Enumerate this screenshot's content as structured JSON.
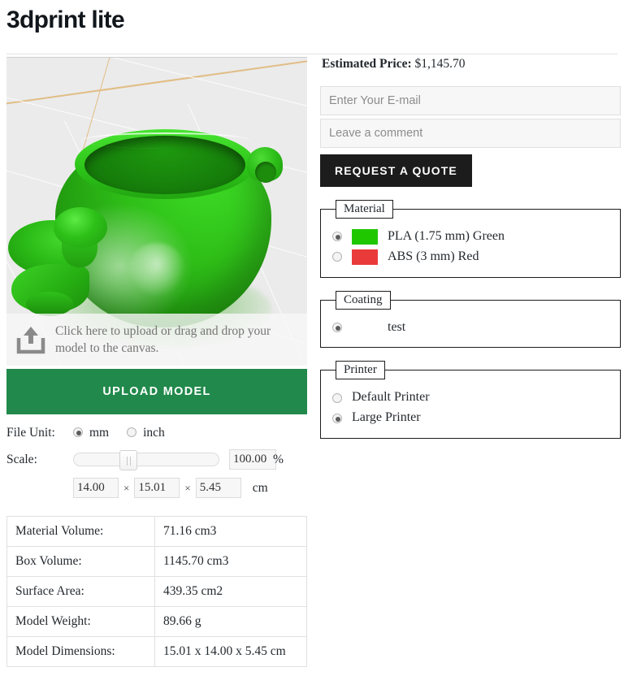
{
  "page": {
    "title": "3dprint lite"
  },
  "viewer": {
    "upload_hint": "Click here to upload or drag and drop your model to the canvas.",
    "upload_icon": "upload-arrow-icon",
    "upload_button_label": "UPLOAD MODEL",
    "model_color": "#2cbd18",
    "background_color": "#ebebeb",
    "button_color": "#21894b"
  },
  "file_unit": {
    "label": "File Unit:",
    "options": [
      {
        "label": "mm",
        "selected": true
      },
      {
        "label": "inch",
        "selected": false
      }
    ]
  },
  "scale": {
    "label": "Scale:",
    "value": "100.00",
    "unit": "%",
    "slider_position_pct": 33
  },
  "dimensions": {
    "x": "14.00",
    "y": "15.01",
    "z": "5.45",
    "separator": "×",
    "unit": "cm"
  },
  "info_table": {
    "rows": [
      {
        "key": "Material Volume:",
        "value": "71.16 cm3"
      },
      {
        "key": "Box Volume:",
        "value": "1145.70 cm3"
      },
      {
        "key": "Surface Area:",
        "value": "439.35 cm2"
      },
      {
        "key": "Model Weight:",
        "value": "89.66 g"
      },
      {
        "key": "Model Dimensions:",
        "value": "15.01 x 14.00 x 5.45 cm"
      }
    ]
  },
  "quote": {
    "price_label": "Estimated Price:",
    "price_value": "$1,145.70",
    "email_placeholder": "Enter Your E-mail",
    "email_value": "",
    "comment_placeholder": "Leave a comment",
    "comment_value": "",
    "button_label": "REQUEST A QUOTE",
    "button_color": "#1c1c1c"
  },
  "material": {
    "legend": "Material",
    "options": [
      {
        "label": "PLA (1.75 mm) Green",
        "color": "#1fc700",
        "selected": true
      },
      {
        "label": "ABS (3 mm) Red",
        "color": "#ea3b3b",
        "selected": false
      }
    ]
  },
  "coating": {
    "legend": "Coating",
    "options": [
      {
        "label": "test",
        "color": "",
        "selected": true
      }
    ]
  },
  "printer": {
    "legend": "Printer",
    "options": [
      {
        "label": "Default Printer",
        "selected": false
      },
      {
        "label": "Large Printer",
        "selected": true
      }
    ]
  }
}
